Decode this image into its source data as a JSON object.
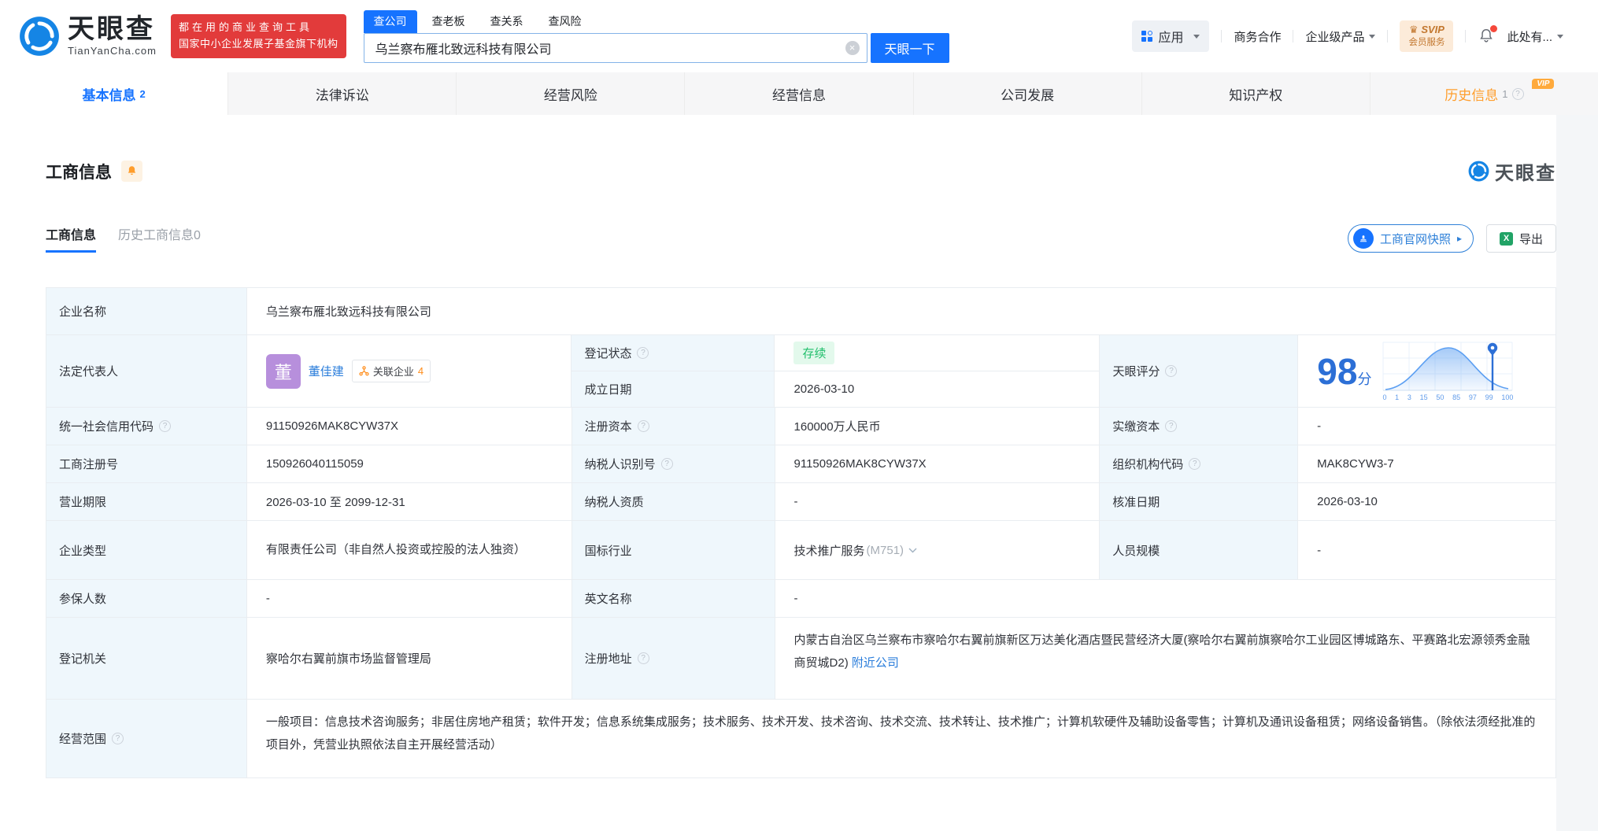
{
  "header": {
    "logo_title": "天眼查",
    "logo_subtitle": "TianYanCha.com",
    "promo_line1": "都在用的商业查询工具",
    "promo_line2": "国家中小企业发展子基金旗下机构",
    "search_tabs": [
      {
        "label": "查公司"
      },
      {
        "label": "查老板"
      },
      {
        "label": "查关系"
      },
      {
        "label": "查风险"
      }
    ],
    "search_value": "乌兰察布雁北致远科技有限公司",
    "search_button": "天眼一下",
    "apps_label": "应用",
    "links": {
      "cooperation": "商务合作",
      "enterprise": "企业级产品",
      "more": "此处有..."
    },
    "svip_line1": "SVIP",
    "svip_line2": "会员服务"
  },
  "tabs": [
    {
      "label": "基本信息",
      "count": "2"
    },
    {
      "label": "法律诉讼"
    },
    {
      "label": "经营风险"
    },
    {
      "label": "经营信息"
    },
    {
      "label": "公司发展"
    },
    {
      "label": "知识产权"
    },
    {
      "label": "历史信息",
      "count": "1",
      "vip": "VIP"
    }
  ],
  "section": {
    "title": "工商信息",
    "watermark": "天眼查",
    "subtab_active": "工商信息",
    "subtab_history": "历史工商信息0",
    "snapshot_button": "工商官网快照",
    "export_button": "导出"
  },
  "fields": {
    "company_name_label": "企业名称",
    "company_name": "乌兰察布雁北致远科技有限公司",
    "legal_rep_label": "法定代表人",
    "legal_rep_avatar": "董",
    "legal_rep_name": "董佳建",
    "related_companies_label": "关联企业",
    "related_companies_count": "4",
    "reg_status_label": "登记状态",
    "reg_status": "存续",
    "establish_date_label": "成立日期",
    "establish_date": "2026-03-10",
    "score_label": "天眼评分",
    "score_value": "98",
    "score_unit": "分",
    "uscc_label": "统一社会信用代码",
    "uscc": "91150926MAK8CYW37X",
    "reg_capital_label": "注册资本",
    "reg_capital": "160000万人民币",
    "paid_capital_label": "实缴资本",
    "paid_capital": "-",
    "reg_no_label": "工商注册号",
    "reg_no": "150926040115059",
    "taxpayer_id_label": "纳税人识别号",
    "taxpayer_id": "91150926MAK8CYW37X",
    "org_code_label": "组织机构代码",
    "org_code": "MAK8CYW3-7",
    "business_term_label": "营业期限",
    "business_term": "2026-03-10 至 2099-12-31",
    "taxpayer_qualification_label": "纳税人资质",
    "taxpayer_qualification": "-",
    "approval_date_label": "核准日期",
    "approval_date": "2026-03-10",
    "company_type_label": "企业类型",
    "company_type": "有限责任公司（非自然人投资或控股的法人独资）",
    "industry_label": "国标行业",
    "industry": "技术推广服务",
    "industry_code": "(M751)",
    "staff_size_label": "人员规模",
    "staff_size": "-",
    "insured_count_label": "参保人数",
    "insured_count": "-",
    "english_name_label": "英文名称",
    "english_name": "-",
    "registry_label": "登记机关",
    "registry": "察哈尔右翼前旗市场监督管理局",
    "address_label": "注册地址",
    "address": "内蒙古自治区乌兰察布市察哈尔右翼前旗新区万达美化酒店暨民营经济大厦(察哈尔右翼前旗察哈尔工业园区博城路东、平赛路北宏源领秀金融商贸城D2)",
    "nearby_link": "附近公司",
    "business_scope_label": "经营范围",
    "business_scope": "一般项目：信息技术咨询服务；非居住房地产租赁；软件开发；信息系统集成服务；技术服务、技术开发、技术咨询、技术交流、技术转让、技术推广；计算机软硬件及辅助设备零售；计算机及通讯设备租赁；网络设备销售。（除依法须经批准的项目外，凭营业执照依法自主开展经营活动）"
  },
  "score_chart": {
    "type": "area",
    "ticks": [
      "0",
      "1",
      "3",
      "15",
      "50",
      "85",
      "97",
      "99",
      "100"
    ],
    "marker_value": 98
  },
  "icons": {
    "help": "?",
    "clear": "×",
    "crown": "♛",
    "excel": "X",
    "snapshot_arrow": "▸"
  },
  "colors": {
    "brand_blue": "#1673ff",
    "score_blue": "#2c6fd6",
    "status_green": "#20bf6b",
    "history_orange": "#ff9d2b",
    "promo_red": "#e23b3b"
  }
}
